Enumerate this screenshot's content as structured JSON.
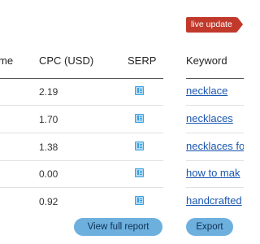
{
  "badge": {
    "label": "live update"
  },
  "table": {
    "headers": {
      "volume_partial": "me",
      "cpc": "CPC (USD)",
      "serp": "SERP",
      "keyword": "Keyword"
    },
    "rows": [
      {
        "cpc": "2.19",
        "serp_icon": "serp-icon",
        "keyword": "necklace"
      },
      {
        "cpc": "1.70",
        "serp_icon": "serp-icon",
        "keyword": "necklaces"
      },
      {
        "cpc": "1.38",
        "serp_icon": "serp-icon",
        "keyword": "necklaces fo"
      },
      {
        "cpc": "0.00",
        "serp_icon": "serp-icon",
        "keyword": "how to mak"
      },
      {
        "cpc": "0.92",
        "serp_icon": "serp-icon",
        "keyword": "handcrafted"
      }
    ]
  },
  "buttons": {
    "view_full_report": "View full report",
    "export": "Export"
  },
  "colors": {
    "badge": "#c0392b",
    "link": "#1a56b0",
    "button": "#6db0de",
    "icon": "#3ba0dd"
  }
}
